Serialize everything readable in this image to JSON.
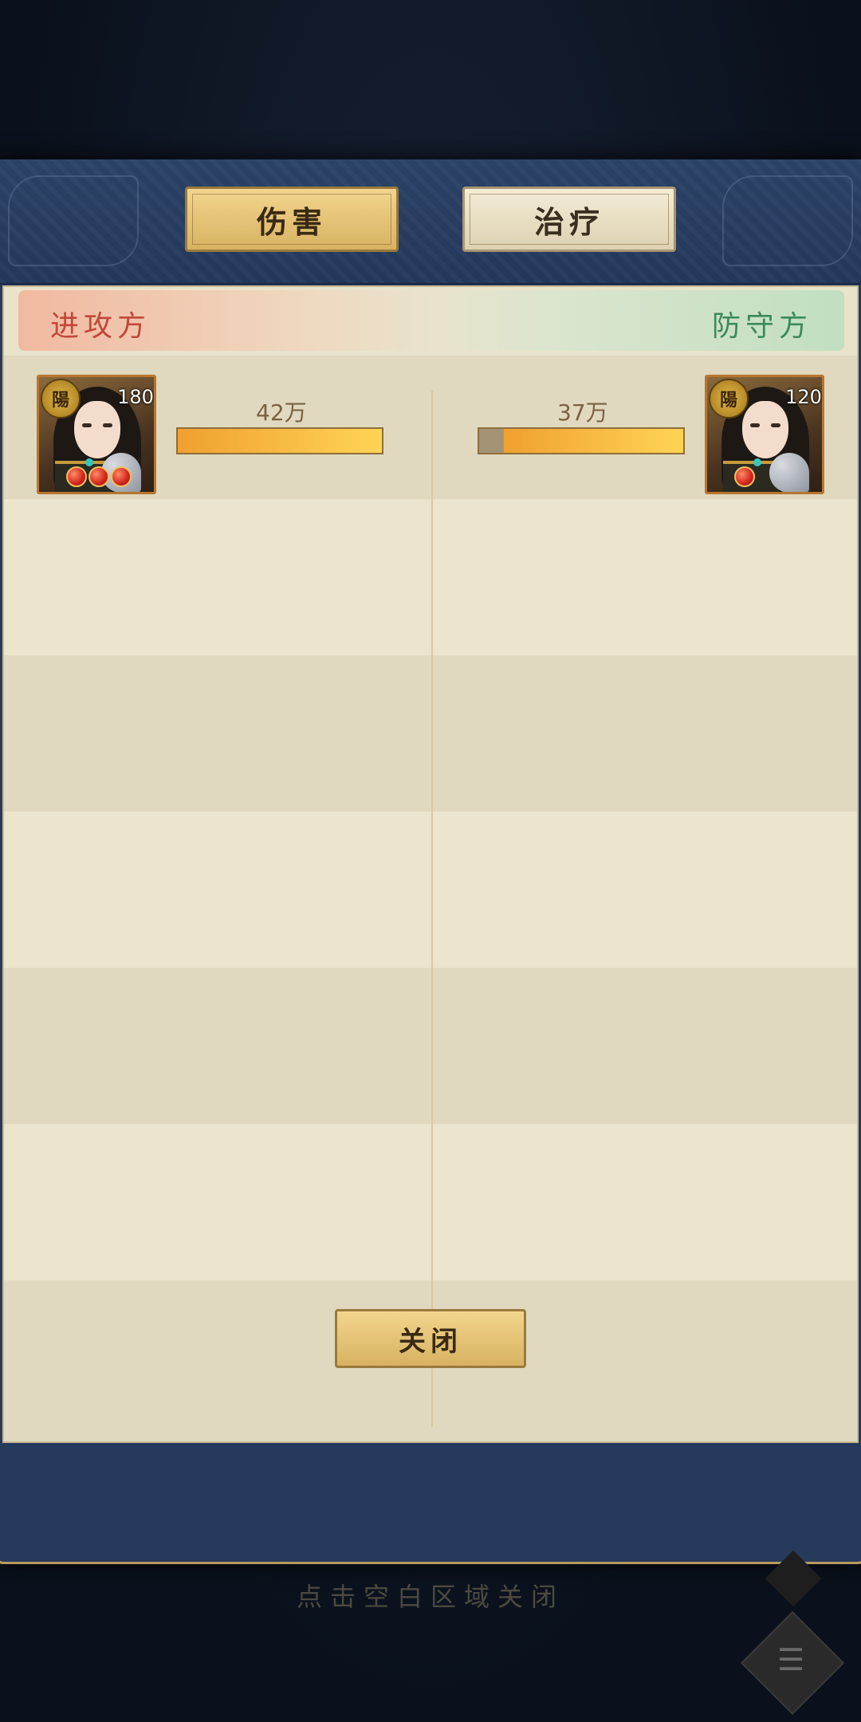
{
  "tabs": [
    {
      "label": "伤害",
      "selected": true
    },
    {
      "label": "治疗",
      "selected": false
    }
  ],
  "sides": {
    "attacker": "进攻方",
    "defender": "防守方"
  },
  "entries": [
    {
      "attacker": {
        "seal": "陽",
        "level": "180",
        "orbs": 3,
        "value_label": "42万",
        "bar_fraction": 1.0
      },
      "defender": {
        "seal": "陽",
        "level": "120",
        "orbs": 1,
        "value_label": "37万",
        "bar_fraction": 0.88
      }
    }
  ],
  "close_button": "关闭",
  "close_hint": "点击空白区域关闭",
  "colors": {
    "panel": "#263a5c",
    "board": "#e9e3cb",
    "bar_fill": "#ffd455",
    "attacker_text": "#c2473a",
    "defender_text": "#3b8a5d"
  },
  "icons": {
    "seal": "yang-seal-icon",
    "menu": "scroll-menu-icon"
  }
}
